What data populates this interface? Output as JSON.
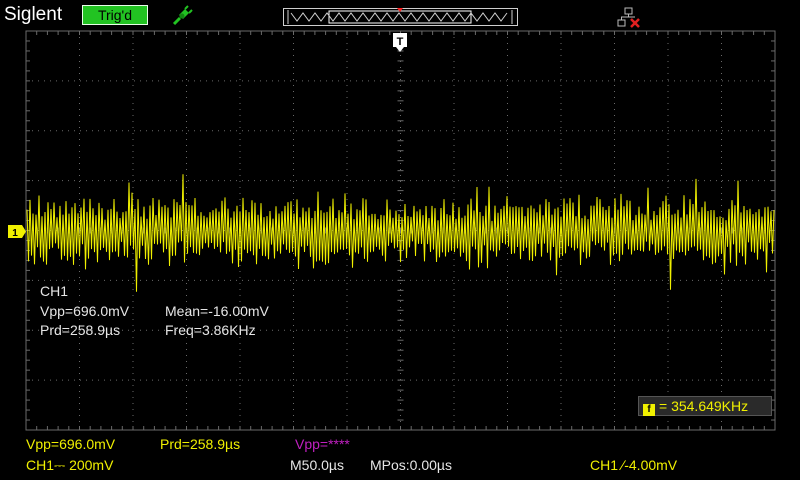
{
  "header": {
    "brand": "Siglent",
    "trigger_status": "Trig'd",
    "probe_icon": "probe-icon",
    "network_icon": "network-disconnected-icon"
  },
  "screen": {
    "trigger_marker": "T",
    "channel_marker": "1"
  },
  "measure_popup": {
    "channel": "CH1",
    "vpp": "Vpp=696.0mV",
    "mean": "Mean=-16.00mV",
    "prd": "Prd=258.9µs",
    "freq": "Freq=3.86KHz"
  },
  "counter": {
    "icon": "f",
    "value": "= 354.649KHz"
  },
  "footer": {
    "vpp": "Vpp=696.0mV",
    "prd": "Prd=258.9µs",
    "vpp2": "Vpp=****",
    "ch1_scale": "CH1⎓ 200mV",
    "timebase": "M50.0µs",
    "mpos": "MPos:0.00µs",
    "trigger_info": "CH1 ∕-4.00mV"
  },
  "colors": {
    "trace": "#f0f000",
    "grid": "#6a6a6a",
    "trig_status_bg": "#22c322",
    "measure_magenta": "#c020c0",
    "accent_orange": "#ff8000",
    "network_red": "#e02020"
  }
}
